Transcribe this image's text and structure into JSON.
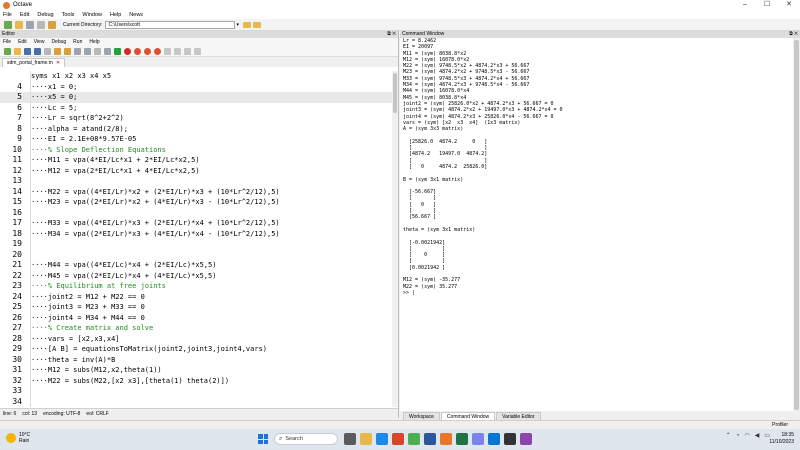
{
  "window": {
    "title": "Octave",
    "min": "–",
    "max": "☐",
    "close": "✕"
  },
  "menubar": [
    "File",
    "Edit",
    "Debug",
    "Tools",
    "Window",
    "Help",
    "News"
  ],
  "toolbar": {
    "current_dir_label": "Current Directory:",
    "current_dir_value": "C:\\Users\\scott"
  },
  "editor": {
    "pane_title": "Editor",
    "menu": [
      "File",
      "Edit",
      "View",
      "Debug",
      "Run",
      "Help"
    ],
    "tab_label": "sdm_portal_frame.m",
    "tab_close": "✕",
    "lines": [
      {
        "n": "4",
        "t": "····x1 = 0;"
      },
      {
        "n": "5",
        "t": "····x5 = 0;",
        "current": true
      },
      {
        "n": "6",
        "t": "····Lc = 5;"
      },
      {
        "n": "7",
        "t": "····Lr = sqrt(8^2+2^2)"
      },
      {
        "n": "8",
        "t": "····alpha = atand(2/8);"
      },
      {
        "n": "9",
        "t": "····EI = 2.1E+08*9.57E-05"
      },
      {
        "n": "10",
        "t": "····% Slope Deflection Equations",
        "comment": true
      },
      {
        "n": "11",
        "t": "····M11 = vpa(4*EI/Lc*x1 + 2*EI/Lc*x2,5)"
      },
      {
        "n": "12",
        "t": "····M12 = vpa(2*EI/Lc*x1 + 4*EI/Lc*x2,5)"
      },
      {
        "n": "13",
        "t": ""
      },
      {
        "n": "14",
        "t": "····M22 = vpa((4*EI/Lr)*x2 + (2*EI/Lr)*x3 + (10*Lr^2/12),5)"
      },
      {
        "n": "15",
        "t": "····M23 = vpa((2*EI/Lr)*x2 + (4*EI/Lr)*x3 - (10*Lr^2/12),5)"
      },
      {
        "n": "16",
        "t": ""
      },
      {
        "n": "17",
        "t": "····M33 = vpa((4*EI/Lr)*x3 + (2*EI/Lr)*x4 + (10*Lr^2/12),5)"
      },
      {
        "n": "18",
        "t": "····M34 = vpa((2*EI/Lr)*x3 + (4*EI/Lr)*x4 - (10*Lr^2/12),5)"
      },
      {
        "n": "19",
        "t": ""
      },
      {
        "n": "20",
        "t": ""
      },
      {
        "n": "21",
        "t": "····M44 = vpa((4*EI/Lc)*x4 + (2*EI/Lc)*x5,5)"
      },
      {
        "n": "22",
        "t": "····M45 = vpa((2*EI/Lc)*x4 + (4*EI/Lc)*x5,5)"
      },
      {
        "n": "23",
        "t": "····% Equilibrium at free joints",
        "comment": true
      },
      {
        "n": "24",
        "t": "····joint2 = M12 + M22 == 0"
      },
      {
        "n": "25",
        "t": "····joint3 = M23 + M33 == 0"
      },
      {
        "n": "26",
        "t": "····joint4 = M34 + M44 == 0"
      },
      {
        "n": "27",
        "t": "····% Create matrix and solve",
        "comment": true
      },
      {
        "n": "28",
        "t": "····vars = [x2,x3,x4]"
      },
      {
        "n": "29",
        "t": "····[A B] = equationsToMatrix(joint2,joint3,joint4,vars)"
      },
      {
        "n": "30",
        "t": "····theta = inv(A)*B"
      },
      {
        "n": "31",
        "t": "····M12 = subs(M12,x2,theta(1))"
      },
      {
        "n": "32",
        "t": "····M22 = subs(M22,[x2 x3],[theta(1) theta(2)])"
      },
      {
        "n": "33",
        "t": ""
      },
      {
        "n": "34",
        "t": ""
      },
      {
        "n": "35",
        "t": ""
      },
      {
        "n": "36",
        "t": ""
      }
    ],
    "header_line": "syms x1 x2 x3 x4 x5",
    "status": {
      "line": "line: 6",
      "col": "col: 13",
      "encoding": "encoding: UTF-8",
      "eol": "eol: CRLF"
    }
  },
  "command_window": {
    "pane_title": "Command Window",
    "output": "Lr = 8.2462\nEI = 20097\nM11 = (sym) 8038.8*x2\nM12 = (sym) 16078.0*x2\nM22 = (sym) 9748.5*x2 + 4874.2*x3 + 56.667\nM23 = (sym) 4874.2*x2 + 9748.5*x3 - 56.667\nM33 = (sym) 9748.5*x3 + 4874.2*x4 + 56.667\nM34 = (sym) 4874.2*x3 + 9748.5*x4 - 56.667\nM44 = (sym) 16078.0*x4\nM45 = (sym) 8038.8*x4\njoint2 = (sym) 25826.0*x2 + 4874.2*x3 + 56.667 = 0\njoint3 = (sym) 4874.2*x2 + 19497.0*x3 + 4874.2*x4 = 0\njoint4 = (sym) 4874.2*x3 + 25826.0*x4 - 56.667 = 0\nvars = (sym) [x2  x3  x4]  (1x3 matrix)\nA = (sym 3x3 matrix)\n\n  [25826.0  4874.2     0   ]\n  [                        ]\n  [4874.2   19497.0  4874.2]\n  [                        ]\n  [   0     4874.2  25826.0]\n\nB = (sym 3x1 matrix)\n\n  [-56.667]\n  [       ]\n  [   0   ]\n  [       ]\n  [56.667 ]\n\ntheta = (sym 3x1 matrix)\n\n  [-0.0021942]\n  [          ]\n  [    0     ]\n  [          ]\n  [0.0021942 ]\n\nM12 = (sym) -35.277\nM22 = (sym) 35.277\n>> |",
    "tabs": [
      "Workspace",
      "Command Window",
      "Variable Editor"
    ]
  },
  "profiler": "Profiler",
  "taskbar": {
    "weather_temp": "10°C",
    "weather_desc": "Rain",
    "search_placeholder": "Search",
    "time": "18:35",
    "date": "11/10/2023"
  }
}
